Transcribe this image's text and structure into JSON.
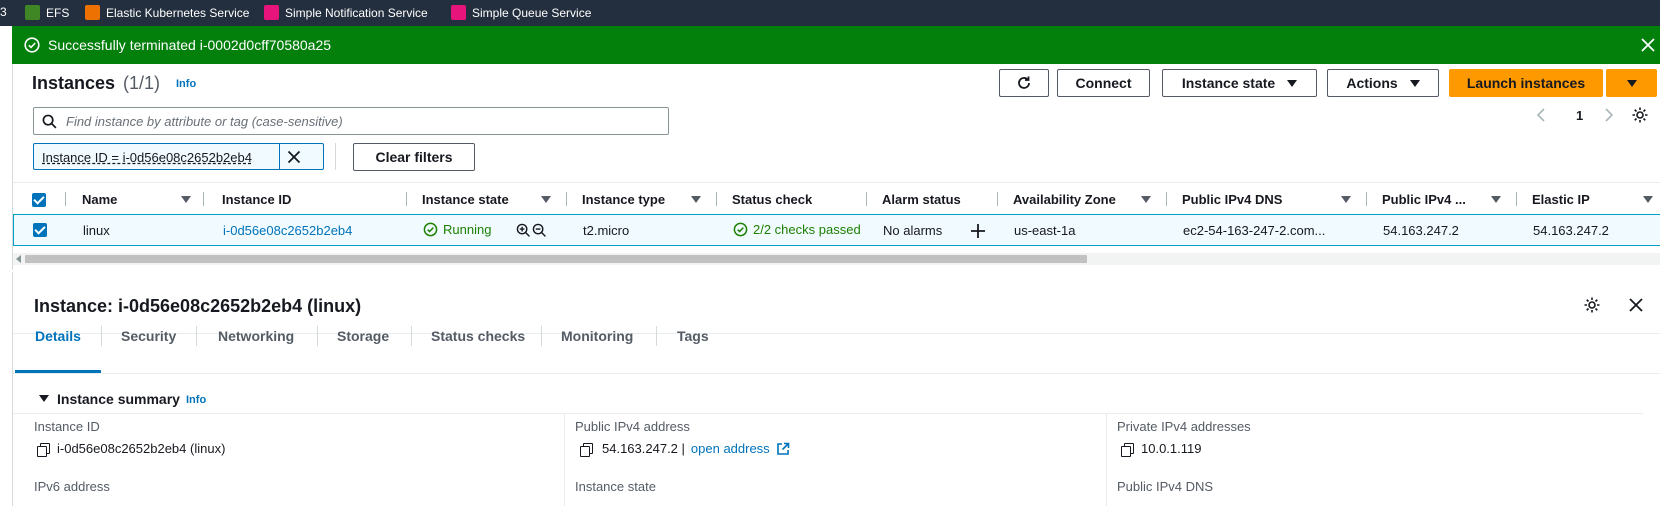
{
  "favorites": [
    {
      "label": "3",
      "color": ""
    },
    {
      "label": "EFS",
      "color": "#3f8624",
      "icon": "efs-icon"
    },
    {
      "label": "Elastic Kubernetes Service",
      "color": "#ed7100",
      "icon": "eks-icon"
    },
    {
      "label": "Simple Notification Service",
      "color": "#e7157b",
      "icon": "sns-icon"
    },
    {
      "label": "Simple Queue Service",
      "color": "#e7157b",
      "icon": "sqs-icon"
    }
  ],
  "flash": {
    "message": "Successfully terminated i-0002d0cff70580a25"
  },
  "instances": {
    "title": "Instances",
    "count": "(1/1)",
    "info": "Info",
    "search_placeholder": "Find instance by attribute or tag (case-sensitive)",
    "filter_token": "Instance ID = i-0d56e08c2652b2eb4",
    "clear_filters": "Clear filters",
    "page": "1",
    "buttons": {
      "connect": "Connect",
      "instance_state": "Instance state",
      "actions": "Actions",
      "launch": "Launch instances"
    }
  },
  "table": {
    "headers": {
      "name": "Name",
      "instance_id": "Instance ID",
      "instance_state": "Instance state",
      "instance_type": "Instance type",
      "status_check": "Status check",
      "alarm_status": "Alarm status",
      "az": "Availability Zone",
      "public_dns": "Public IPv4 DNS",
      "public_ip": "Public IPv4 ...",
      "elastic_ip": "Elastic IP"
    },
    "row": {
      "name": "linux",
      "instance_id": "i-0d56e08c2652b2eb4",
      "instance_state": "Running",
      "instance_type": "t2.micro",
      "status_check": "2/2 checks passed",
      "alarm_status": "No alarms",
      "az": "us-east-1a",
      "public_dns": "ec2-54-163-247-2.com...",
      "public_ip": "54.163.247.2",
      "elastic_ip": "54.163.247.2"
    }
  },
  "detail": {
    "title": "Instance: i-0d56e08c2652b2eb4 (linux)",
    "tabs": [
      "Details",
      "Security",
      "Networking",
      "Storage",
      "Status checks",
      "Monitoring",
      "Tags"
    ],
    "summary_title": "Instance summary",
    "summary_info": "Info",
    "fields": {
      "instance_id_label": "Instance ID",
      "instance_id_value": "i-0d56e08c2652b2eb4 (linux)",
      "public_ip_label": "Public IPv4 address",
      "public_ip_value": "54.163.247.2 |",
      "open_address": "open address",
      "private_ip_label": "Private IPv4 addresses",
      "private_ip_value": "10.0.1.119",
      "ipv6_label": "IPv6 address",
      "instance_state_label": "Instance state",
      "public_dns_label": "Public IPv4 DNS"
    }
  },
  "colors": {
    "accent": "#ff9900",
    "success": "#037f0c",
    "link": "#0073bb",
    "running": "#1d8102"
  }
}
